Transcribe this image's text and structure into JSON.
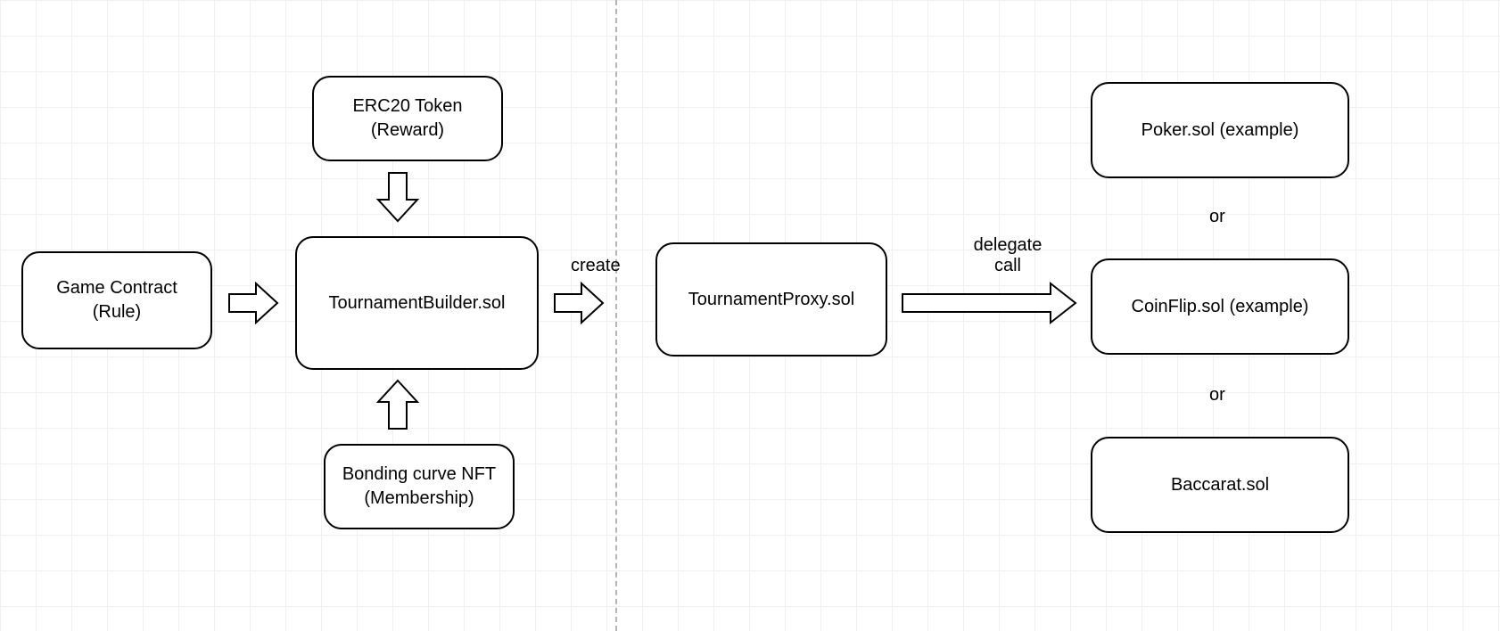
{
  "nodes": {
    "game_contract": "Game Contract\n(Rule)",
    "erc20": "ERC20 Token\n(Reward)",
    "bonding_nft": "Bonding curve NFT\n(Membership)",
    "builder": "TournamentBuilder.sol",
    "proxy": "TournamentProxy.sol",
    "poker": "Poker.sol (example)",
    "coinflip": "CoinFlip.sol (example)",
    "baccarat": "Baccarat.sol"
  },
  "labels": {
    "create": "create",
    "delegate": "delegate\ncall",
    "or1": "or",
    "or2": "or"
  }
}
